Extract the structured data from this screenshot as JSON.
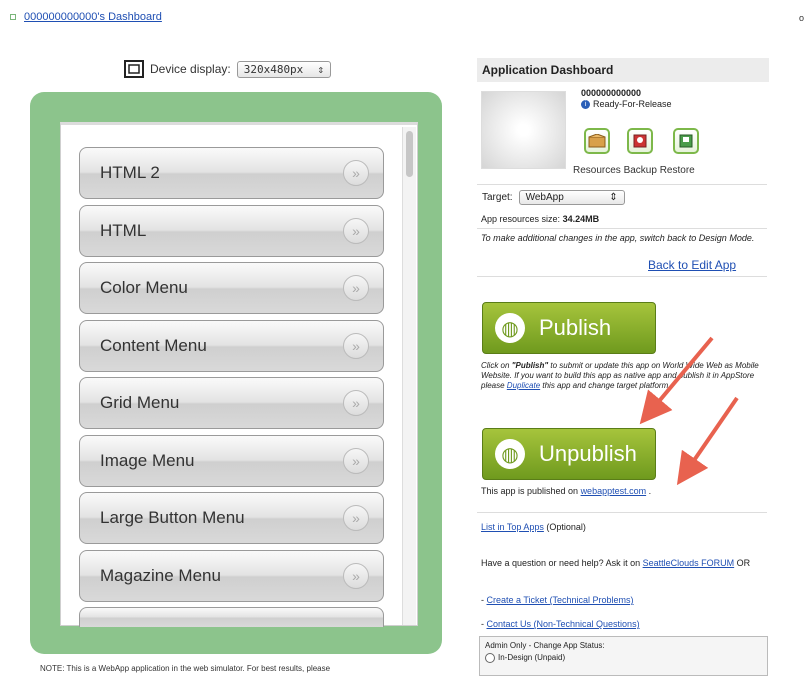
{
  "breadcrumb": {
    "dashboard_link": "000000000000's Dashboard"
  },
  "top_right_text": "o",
  "device": {
    "label": "Device display:",
    "value": "320x480px",
    "arrow": "⇕"
  },
  "menu_items": [
    "HTML 2",
    "HTML",
    "Color Menu",
    "Content Menu",
    "Grid Menu",
    "Image Menu",
    "Large Button Menu",
    "Magazine Menu"
  ],
  "chevron_glyph": "»",
  "note_text": "NOTE: This is a WebApp application in the web simulator. For best results, please",
  "dashboard": {
    "title": "Application Dashboard",
    "app_name": "000000000000",
    "status": "Ready-For-Release",
    "tool_labels": "Resources Backup Restore",
    "target_label": "Target:",
    "target_value": "WebApp",
    "res_size_label": "App resources size:",
    "res_size_value": "34.24MB",
    "edit_note": "To make additional changes in the app, switch back to Design Mode.",
    "back_link": "Back to Edit App",
    "publish_label": "Publish",
    "publish_note_prefix": "Click on ",
    "publish_note_bold": "\"Publish\"",
    "publish_note_rest": " to submit or update this app on World Wide Web as Mobile Website. If you want to build this app as native app and publish it in AppStore please ",
    "duplicate_link": "Duplicate",
    "publish_note_end": " this app and change target platform.",
    "unpublish_label": "Unpublish",
    "published_on_prefix": "This app is published on ",
    "published_on_link": "webapptest.com",
    "published_on_suffix": " .",
    "list_top_link": "List in Top Apps",
    "list_top_suffix": " (Optional)",
    "help_prefix": "Have a question or need help? Ask it on ",
    "help_link": "SeattleClouds FORUM",
    "help_suffix": " OR",
    "ticket_prefix": "- ",
    "ticket_link": "Create a Ticket (Technical Problems)",
    "contact_prefix": "- ",
    "contact_link": "Contact Us (Non-Technical Questions)",
    "admin_label": "Admin Only - Change App Status:",
    "admin_option": "In-Design (Unpaid)"
  },
  "colors": {
    "frame": "#8cc48c",
    "button_green": "#8ab22f",
    "arrow": "#e8624f"
  }
}
